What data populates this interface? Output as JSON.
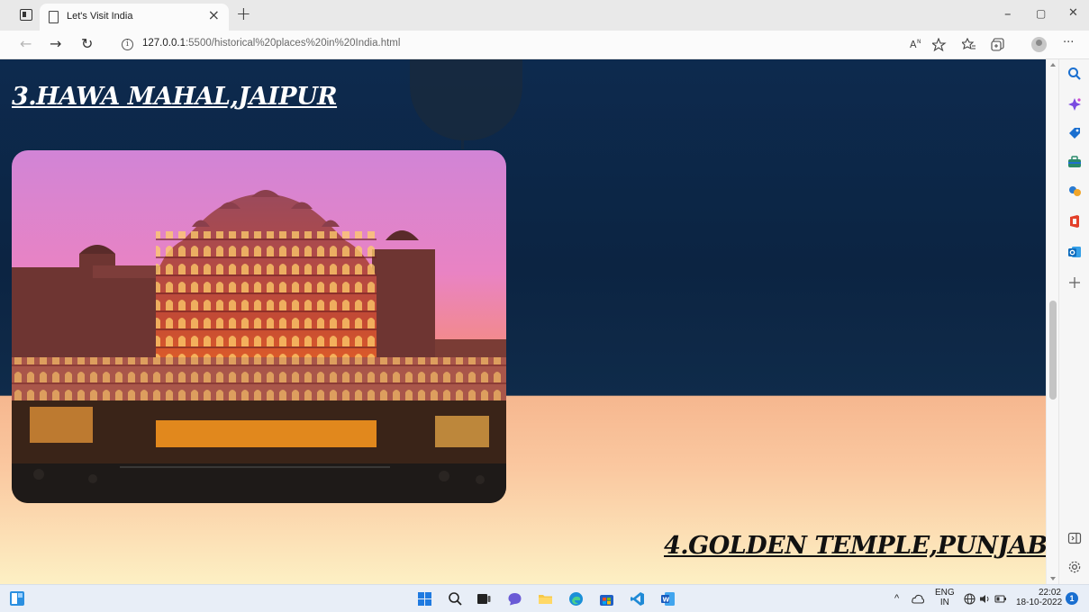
{
  "browser": {
    "tab_title": "Let's Visit India",
    "tab_close": "×",
    "new_tab": "+",
    "window_controls": {
      "minimize": "–",
      "restore": "▢",
      "close": "✕"
    },
    "url_host": "127.0.0.1",
    "url_rest": ":5500/historical%20places%20in%20India.html",
    "toolbar_icons": [
      "read-aloud-icon",
      "favorites-add-icon",
      "favorites-icon",
      "collections-icon",
      "profile-icon",
      "more-icon"
    ],
    "more": "···"
  },
  "page": {
    "section_3_title": "3.HAWA MAHAL,JAIPUR",
    "section_4_title": "4.GOLDEN TEMPLE,PUNJAB"
  },
  "sidebar": {
    "icons": [
      "search-icon",
      "copilot-icon",
      "shopping-icon",
      "tools-icon",
      "games-icon",
      "office-icon",
      "outlook-icon",
      "add-icon",
      "hide-sidebar-icon",
      "settings-icon"
    ]
  },
  "taskbar": {
    "apps": [
      "start-icon",
      "search-icon",
      "task-view-icon",
      "chat-icon",
      "file-explorer-icon",
      "edge-icon",
      "store-icon",
      "vscode-icon",
      "word-icon"
    ],
    "lang_top": "ENG",
    "lang_bottom": "IN",
    "time": "22:02",
    "date": "18-10-2022",
    "notifications": "1"
  },
  "colors": {
    "sky_top": "#0d2a4e",
    "sunset_band": "#f6b78f",
    "title_light": "#ffffff",
    "title_dark": "#111111"
  }
}
